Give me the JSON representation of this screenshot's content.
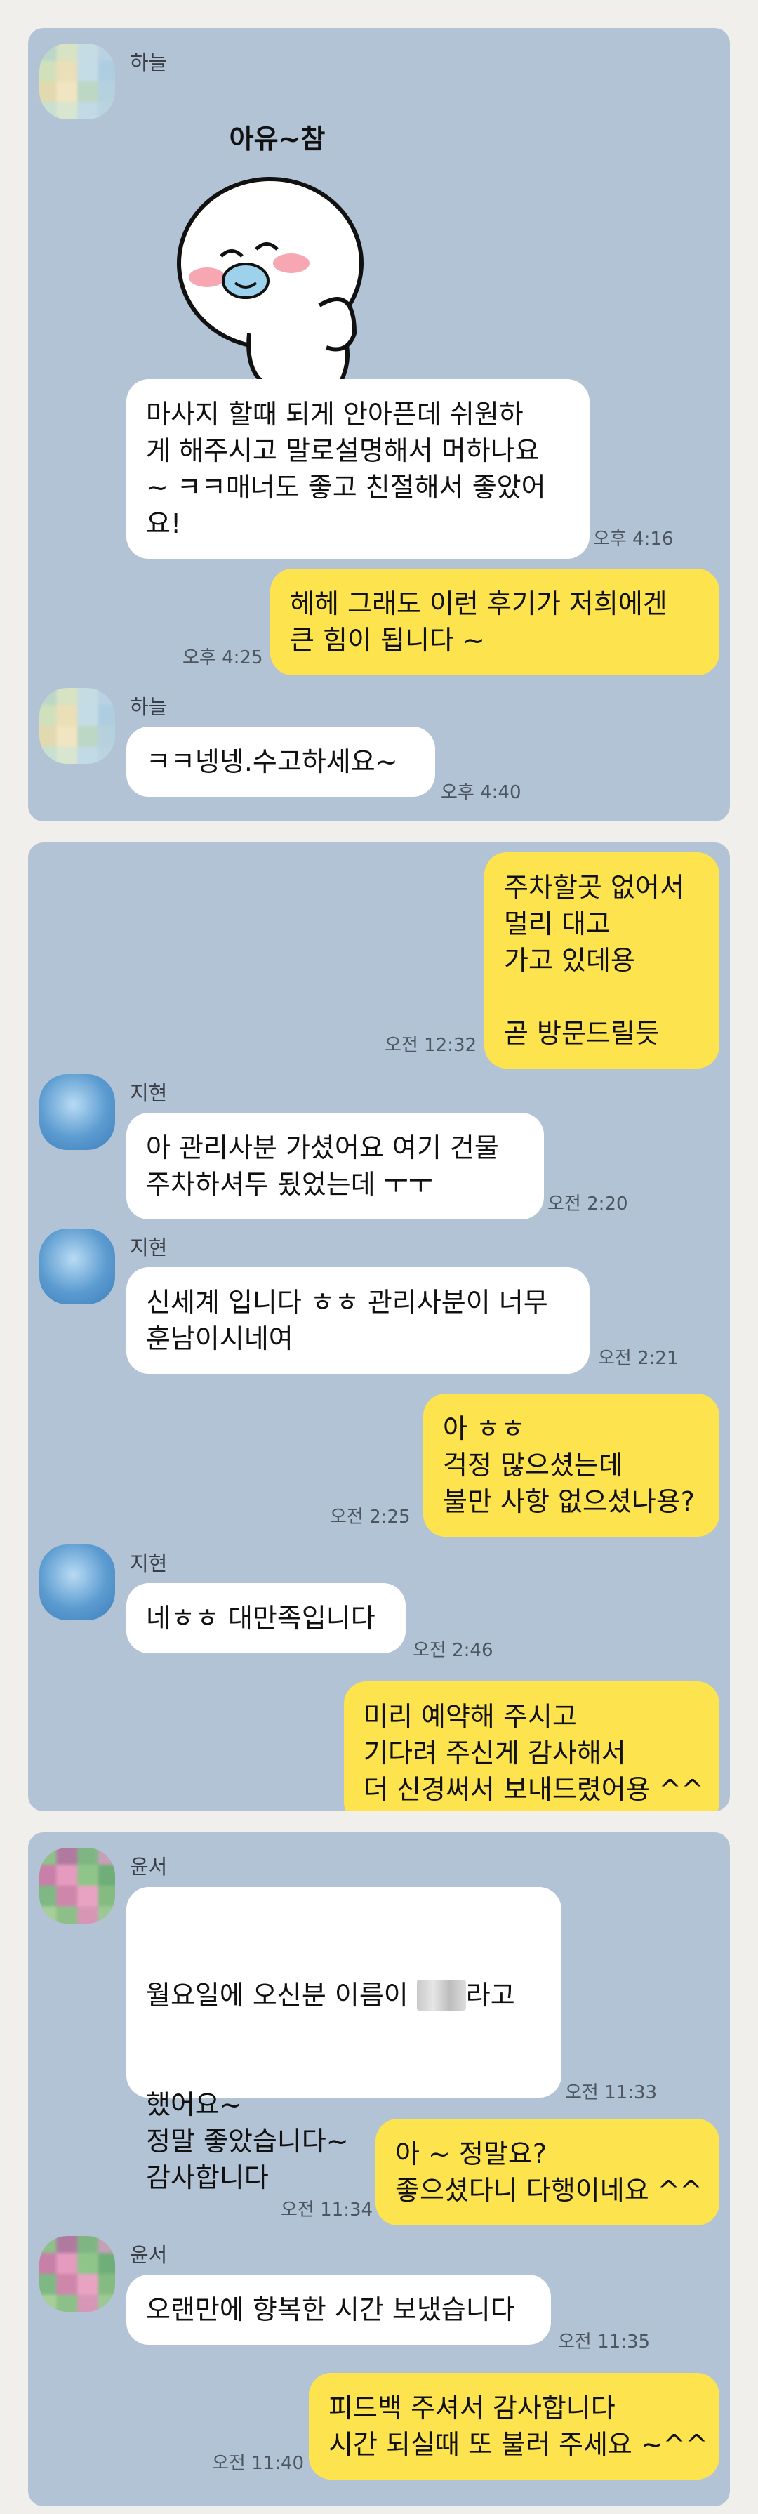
{
  "panel1": {
    "contact_name": "하늘",
    "sticker_caption": "아유~참",
    "msg1": "마사지 할때 되게 안아픈데 쉬원하\n게 해주시고 말로설명해서 머하나요\n~ ㅋㅋ매너도 좋고 친절해서 좋았어\n요!",
    "msg1_time": "오후 4:16",
    "reply1": "헤헤 그래도 이런 후기가 저희에겐\n큰 힘이 됩니다 ~",
    "reply1_time": "오후 4:25",
    "contact_name_2": "하늘",
    "msg2": "ㅋㅋ넹넹.수고하세요~",
    "msg2_time": "오후 4:40"
  },
  "panel2": {
    "out1": "주차할곳 없어서\n멀리 대고\n가고 있데용\n\n곧 방문드릴듯",
    "out1_time": "오전 12:32",
    "contact_name": "지현",
    "in1": "아 관리사분 가셨어요 여기 건물\n주차하셔두 됬었는데 ㅜㅜ",
    "in1_time": "오전 2:20",
    "contact_name_2": "지현",
    "in2": "신세계 입니다 ㅎㅎ 관리사분이 너무\n훈남이시네여",
    "in2_time": "오전 2:21",
    "out2": "아 ㅎㅎ\n걱정 많으셨는데\n불만 사항 없으셨나용?",
    "out2_time": "오전 2:25",
    "contact_name_3": "지현",
    "in3": "네ㅎㅎ 대만족입니다",
    "in3_time": "오전 2:46",
    "out3": "미리 예약해 주시고\n기다려 주신게 감사해서\n더 신경써서 보내드렸어용 ^^",
    "out3_time": ""
  },
  "panel3": {
    "contact_name": "윤서",
    "in1_prefix": "월요일에 오신분 이름이 ",
    "in1_redacted": "ㅇㅇ",
    "in1_suffix": "라고",
    "in1_rest": "했어요~\n정말 좋았습니다~\n감사합니다",
    "in1_time": "오전 11:33",
    "out1": "아 ~ 정말요?\n좋으셨다니 다행이네요 ^^",
    "out1_time": "오전 11:34",
    "contact_name_2": "윤서",
    "in2": "오랜만에 향복한 시간 보냈습니다",
    "in2_time": "오전 11:35",
    "out2": "피드백 주셔서 감사합니다\n시간 되실때 또 불러 주세요 ~^^",
    "out2_time": "오전 11:40"
  },
  "colors": {
    "chat_bg": "#b2c3d5",
    "incoming_bubble": "#ffffff",
    "outgoing_bubble": "#fde34e",
    "page_bg": "#f1efeb"
  }
}
